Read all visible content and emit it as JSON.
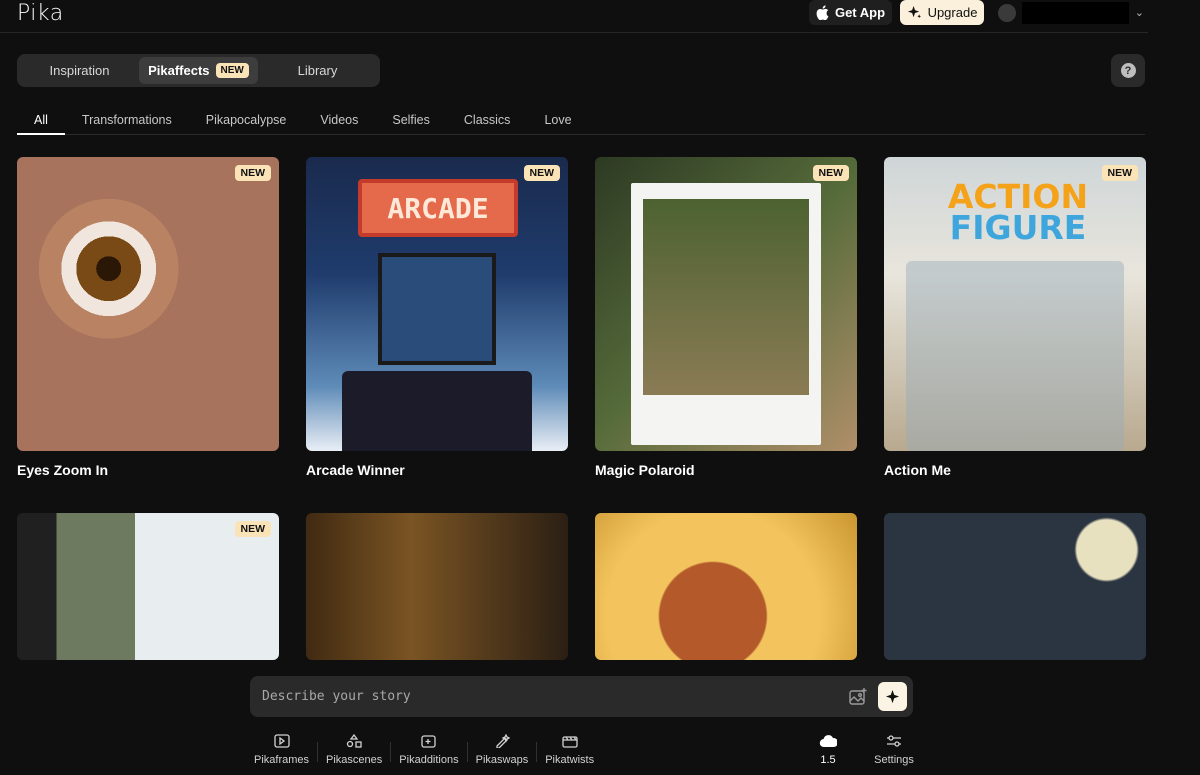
{
  "header": {
    "logo": "Pika",
    "get_app_label": "Get App",
    "upgrade_label": "Upgrade"
  },
  "main_tabs": [
    {
      "label": "Inspiration",
      "active": false
    },
    {
      "label": "Pikaffects",
      "active": true,
      "badge": "NEW"
    },
    {
      "label": "Library",
      "active": false
    }
  ],
  "help_label": "?",
  "categories": [
    "All",
    "Transformations",
    "Pikapocalypse",
    "Videos",
    "Selfies",
    "Classics",
    "Love"
  ],
  "active_category": "All",
  "cards": [
    {
      "title": "Eyes Zoom In",
      "badge": "NEW"
    },
    {
      "title": "Arcade Winner",
      "badge": "NEW"
    },
    {
      "title": "Magic Polaroid",
      "badge": "NEW"
    },
    {
      "title": "Action Me",
      "badge": "NEW"
    },
    {
      "title": "",
      "badge": "NEW"
    },
    {
      "title": "",
      "badge": ""
    },
    {
      "title": "",
      "badge": ""
    },
    {
      "title": "",
      "badge": ""
    }
  ],
  "card_art_text": {
    "arcade": "ARCADE",
    "action_line1": "ACTION",
    "action_line2": "FIGURE"
  },
  "story": {
    "placeholder": "Describe your story"
  },
  "tools": [
    {
      "label": "Pikaframes",
      "icon": "frames-icon"
    },
    {
      "label": "Pikascenes",
      "icon": "scenes-icon"
    },
    {
      "label": "Pikadditions",
      "icon": "additions-icon"
    },
    {
      "label": "Pikaswaps",
      "icon": "swaps-icon"
    },
    {
      "label": "Pikatwists",
      "icon": "twists-icon"
    }
  ],
  "model_version": "1.5",
  "settings_label": "Settings",
  "colors": {
    "background": "#0f0f0f",
    "accent": "#fbe3b8",
    "panel": "#2a2a2a"
  }
}
